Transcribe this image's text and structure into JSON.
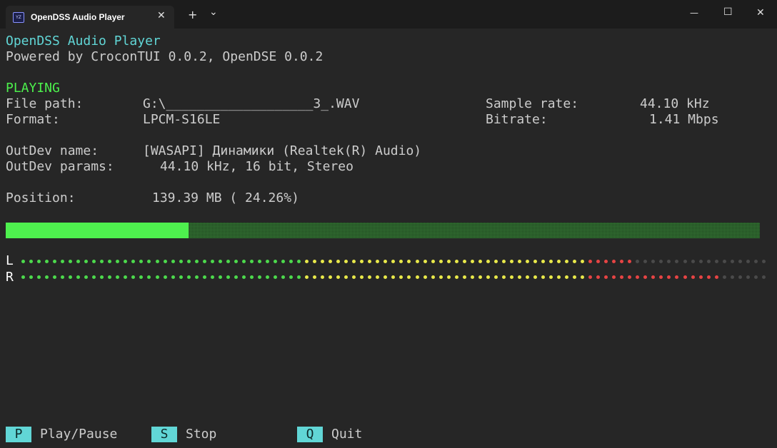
{
  "window": {
    "tab_title": "OpenDSS Audio Player",
    "tab_icon_text": "YZ",
    "close_tab": "✕",
    "new_tab": "+",
    "dropdown": "⌄",
    "minimize": "—",
    "maximize": "☐",
    "close": "✕"
  },
  "header": {
    "title": "OpenDSS Audio Player",
    "powered": "Powered by CroconTUI 0.0.2, OpenDSE 0.0.2"
  },
  "status": "PLAYING",
  "file": {
    "path_label": "File path:",
    "path_value": "G:\\___________________3_.WAV",
    "format_label": "Format:",
    "format_value": "LPCM-S16LE",
    "rate_label": "Sample rate:",
    "rate_value": "44.10 kHz",
    "bitrate_label": "Bitrate:",
    "bitrate_value": "1.41 Mbps"
  },
  "outdev": {
    "name_label": "OutDev name:",
    "name_value": "[WASAPI] Динамики (Realtek(R) Audio)",
    "params_label": "OutDev params:",
    "params_value": "44.10 kHz, 16 bit, Stereo"
  },
  "position": {
    "label": "Position:",
    "value": "139.39 MB ( 24.26%)",
    "fraction": 0.2426
  },
  "meters": {
    "total_dots": 95,
    "left": {
      "label": "L",
      "green": 36,
      "yellow": 36,
      "red": 6
    },
    "right": {
      "label": "R",
      "green": 36,
      "yellow": 36,
      "red": 17
    },
    "colors": {
      "green": "#4cd94c",
      "yellow": "#e8e84a",
      "red": "#e64444",
      "off": "#4a4a4a"
    }
  },
  "keys": [
    {
      "key": "P",
      "label": "Play/Pause"
    },
    {
      "key": "S",
      "label": "Stop"
    },
    {
      "key": "Q",
      "label": "Quit"
    }
  ]
}
